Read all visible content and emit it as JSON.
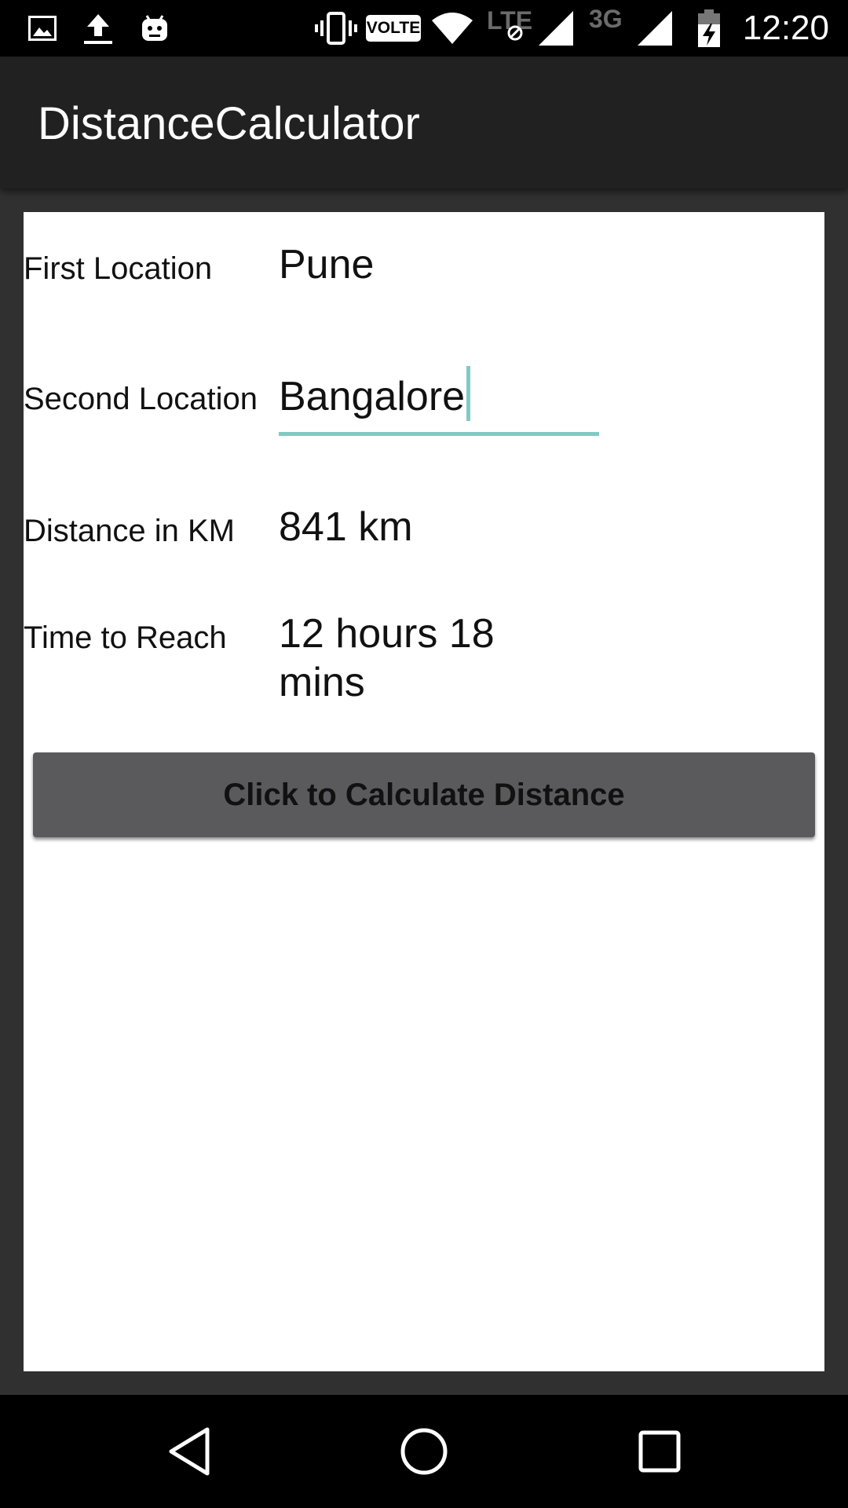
{
  "status_bar": {
    "left_icons": [
      "gallery-icon",
      "upload-icon",
      "android-icon"
    ],
    "right_icons": [
      "vibrate-icon",
      "volte-icon",
      "wifi-icon",
      "lte-signal-icon",
      "3g-signal-icon",
      "battery-charging-icon"
    ],
    "volte_label": "VOLTE",
    "lte_label": "LTE",
    "threeg_label": "3G",
    "time": "12:20"
  },
  "app_bar": {
    "title": "DistanceCalculator"
  },
  "form": {
    "first_location_label": "First Location",
    "first_location_value": "Pune",
    "second_location_label": "Second Location",
    "second_location_value": "Bangalore",
    "distance_label": "Distance in KM",
    "distance_value": "841 km",
    "time_label": "Time to Reach",
    "time_value": "12 hours 18 mins",
    "calculate_button_label": "Click to Calculate Distance"
  },
  "nav_bar": {
    "icons": [
      "back-icon",
      "home-icon",
      "recents-icon"
    ]
  },
  "colors": {
    "accent": "#80cbc4",
    "app_bar": "#212121",
    "background": "#303030",
    "button": "#5a5a5c"
  }
}
